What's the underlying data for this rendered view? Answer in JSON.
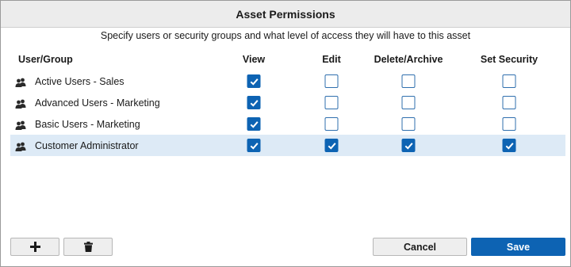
{
  "dialog": {
    "title": "Asset Permissions",
    "instructions": "Specify users or security groups and what level of access they will have to this asset"
  },
  "columns": {
    "user": "User/Group",
    "view": "View",
    "edit": "Edit",
    "delete": "Delete/Archive",
    "security": "Set Security"
  },
  "rows": [
    {
      "name": "Active Users - Sales",
      "view": true,
      "edit": false,
      "delete": false,
      "security": false,
      "selected": false
    },
    {
      "name": "Advanced Users - Marketing",
      "view": true,
      "edit": false,
      "delete": false,
      "security": false,
      "selected": false
    },
    {
      "name": "Basic Users - Marketing",
      "view": true,
      "edit": false,
      "delete": false,
      "security": false,
      "selected": false
    },
    {
      "name": "Customer Administrator",
      "view": true,
      "edit": true,
      "delete": true,
      "security": true,
      "selected": true
    }
  ],
  "buttons": {
    "add_icon": "plus-icon",
    "delete_icon": "trash-icon",
    "cancel": "Cancel",
    "save": "Save"
  },
  "colors": {
    "accent": "#0d63b3",
    "selected_row": "#ddeaf6"
  }
}
